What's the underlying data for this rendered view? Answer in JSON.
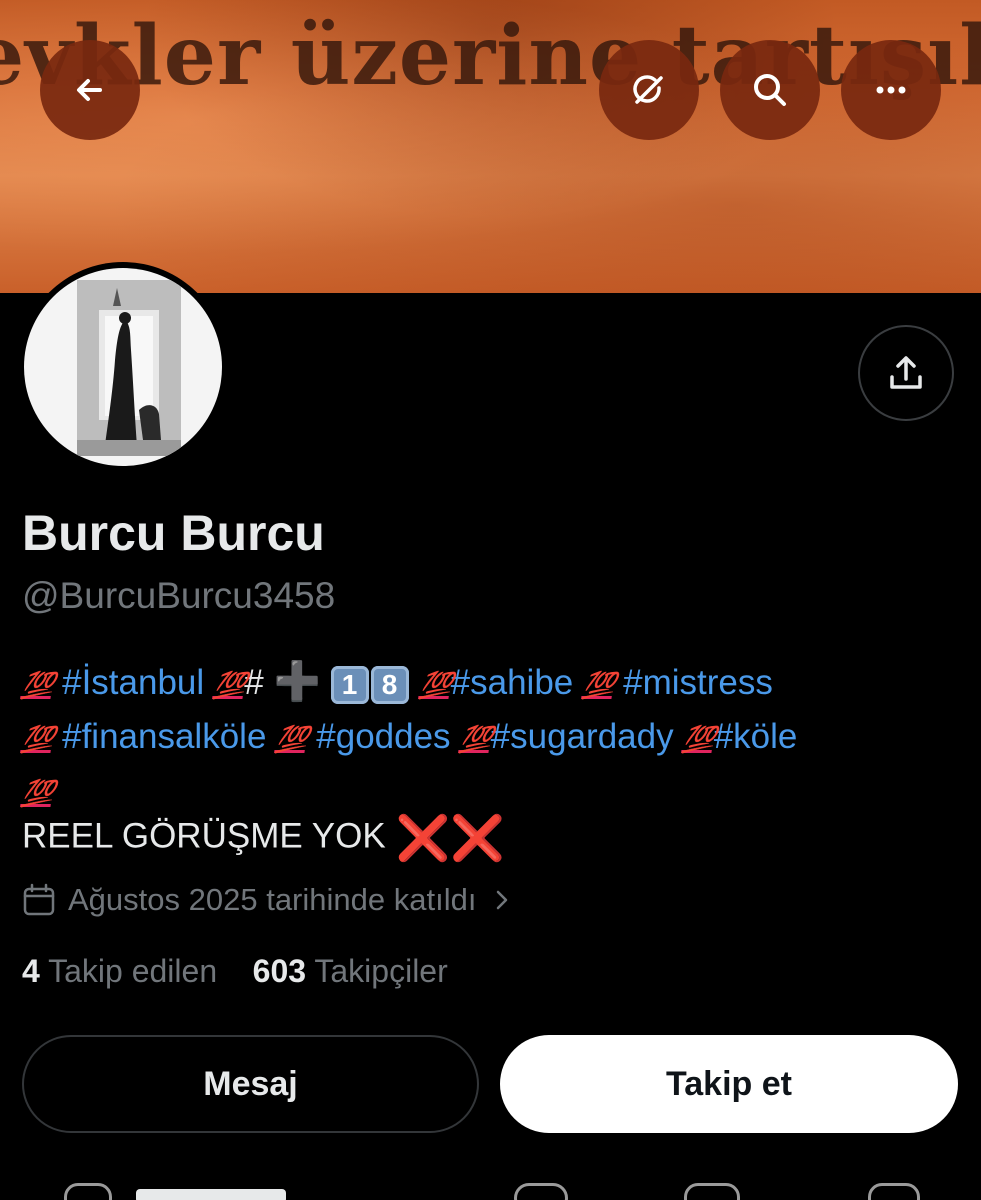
{
  "banner": {
    "text": "evkler üzerine tartışılma"
  },
  "header": {
    "back": "back-arrow-icon",
    "grok": "grok-icon",
    "search": "search-icon",
    "more": "more-icon"
  },
  "profile": {
    "name": "Burcu Burcu",
    "handle": "@BurcuBurcu3458",
    "bio": {
      "line1": {
        "h1": "#İstanbul",
        "h2": "#",
        "k1": "1",
        "k2": "8",
        "h3": "#sahibe",
        "h4": "#mistress"
      },
      "line2": {
        "h5": "#finansalköle",
        "h6": "#goddes",
        "h7": "#sugardady",
        "h8": "#köle"
      },
      "emoji_100": "💯",
      "emoji_plus": "➕",
      "reel": "REEL GÖRÜŞME YOK",
      "xmark": "❌"
    },
    "joined": "Ağustos 2025 tarihinde katıldı",
    "following_count": "4",
    "following_label": "Takip edilen",
    "followers_count": "603",
    "followers_label": "Takipçiler"
  },
  "actions": {
    "message": "Mesaj",
    "follow": "Takip et"
  },
  "colors": {
    "accent": "#4a99e9",
    "banner": "#d36b34",
    "header_button": "#782a0f"
  }
}
